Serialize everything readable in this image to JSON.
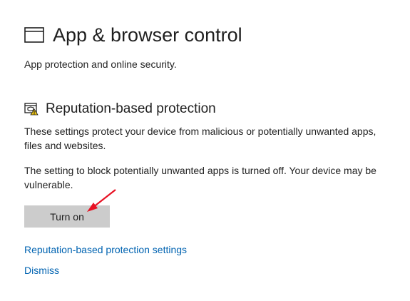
{
  "header": {
    "title": "App & browser control",
    "icon": "window-icon",
    "subtitle": "App protection and online security."
  },
  "section": {
    "icon": "shield-warning-icon",
    "title": "Reputation-based protection",
    "description": "These settings protect your device from malicious or potentially unwanted apps, files and websites.",
    "warning": "The setting to block potentially unwanted apps is turned off. Your device may be vulnerable.",
    "button_label": "Turn on",
    "settings_link": "Reputation-based protection settings",
    "dismiss_link": "Dismiss"
  },
  "colors": {
    "accent_link": "#0063b1",
    "button_bg": "#cccccc",
    "warning_badge": "#f2c811",
    "annotation_arrow": "#e81123"
  }
}
